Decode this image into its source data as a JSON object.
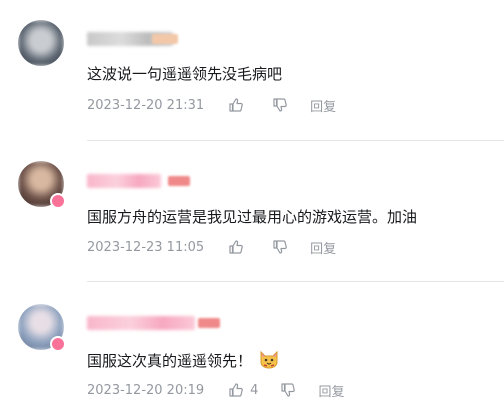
{
  "comments": [
    {
      "text": "这波说一句遥遥领先没毛病吧",
      "time": "2023-12-20 21:31",
      "like_count": "",
      "reply_label": "回复",
      "avatar_color": "#5a6470",
      "badge_color": ""
    },
    {
      "text": "国服方舟的运营是我见过最用心的游戏运营。加油",
      "time": "2023-12-23 11:05",
      "like_count": "",
      "reply_label": "回复",
      "avatar_color": "#6b5048",
      "badge_color": "#fb7299"
    },
    {
      "text": "国服这次真的遥遥领先！",
      "time": "2023-12-20 20:19",
      "like_count": "4",
      "reply_label": "回复",
      "avatar_color": "#8fa3c0",
      "badge_color": "#fb7299"
    }
  ],
  "colors": {
    "meta_text": "#9499a0",
    "comment_text": "#18191c",
    "vip_pink": "#fb7299",
    "divider": "#e3e5e7"
  },
  "icons": {
    "like": "thumbs-up-icon",
    "dislike": "thumbs-down-icon",
    "emoji": "cat-face-emoji-icon"
  }
}
